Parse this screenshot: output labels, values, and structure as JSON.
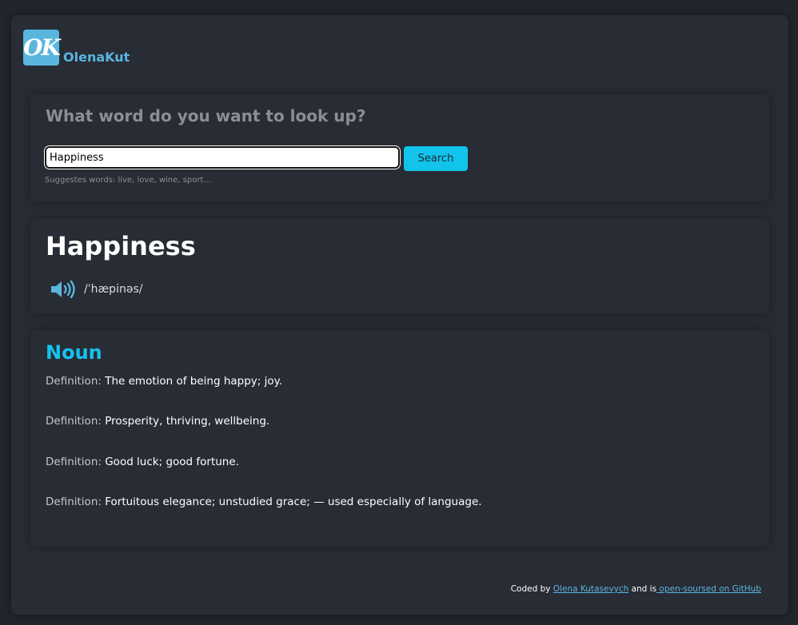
{
  "brand": {
    "logo_text": "OK",
    "name": "OlenaKut"
  },
  "search": {
    "question": "What word do you want to look up?",
    "value": "Happiness",
    "button_label": "Search",
    "suggestions": "Suggestes words: live, love, wine, sport..."
  },
  "word": {
    "title": "Happiness",
    "phonetic": "/ˈhæpinəs/",
    "audio_icon": "speaker-icon"
  },
  "meaning": {
    "part_of_speech": "Noun",
    "definition_label": "Definition:",
    "definitions": [
      "The emotion of being happy; joy.",
      "Prosperity, thriving, wellbeing.",
      "Good luck; good fortune.",
      "Fortuitous elegance; unstudied grace; — used especially of language."
    ]
  },
  "footer": {
    "prefix": "Coded by ",
    "author_link": "Olena Kutasevych",
    "middle": " and is",
    "github_link": " open-soursed on GitHub"
  },
  "colors": {
    "accent": "#12c3ec",
    "brand": "#5ab5df",
    "background": "#282c35"
  }
}
